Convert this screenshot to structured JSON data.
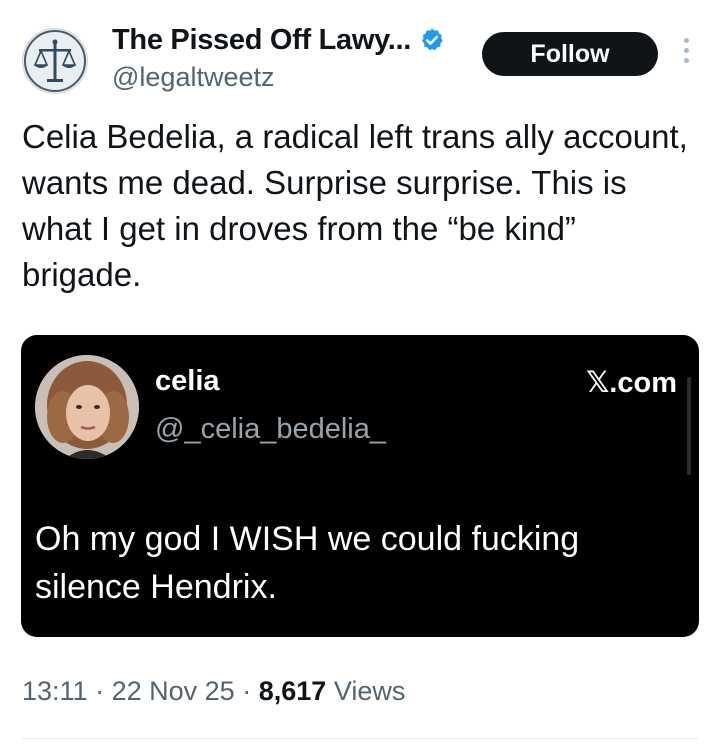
{
  "tweet": {
    "author": {
      "display_name": "The Pissed Off Lawy...",
      "handle": "@legaltweetz",
      "verified": true,
      "avatar_icon": "scales-of-justice-icon"
    },
    "follow_label": "Follow",
    "more_icon": "more-vertical-icon",
    "text": "Celia Bedelia, a radical left trans ally account, wants me dead. Surprise surprise. This is what I get in droves from the “be kind” brigade.",
    "embedded": {
      "name": "celia",
      "handle": "@_celia_bedelia_",
      "source": "𝕏.com",
      "text": "Oh my god I WISH we could fucking silence Hendrix."
    },
    "time": "13:11",
    "separator": "·",
    "date": "22 Nov 25",
    "views_count": "8,617",
    "views_label": "Views"
  },
  "colors": {
    "verified": "#1d9bf0",
    "muted": "#536471",
    "text": "#0f1419",
    "embed_bg": "#000000"
  }
}
